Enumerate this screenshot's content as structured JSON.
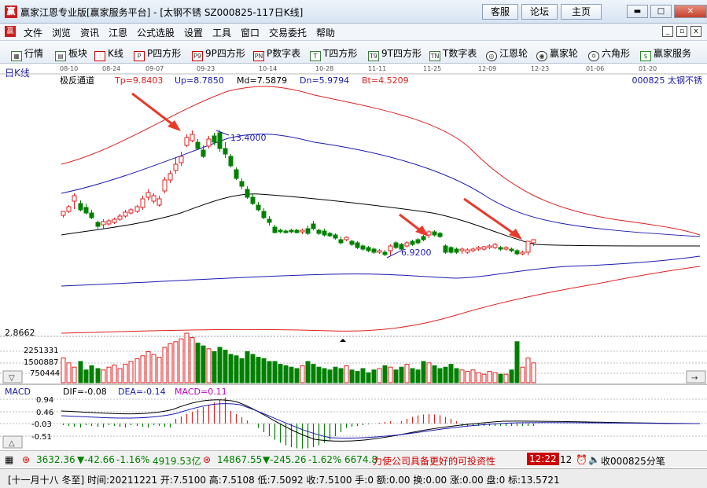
{
  "window": {
    "title": "赢家江恩专业版[赢家服务平台] - [太钢不锈  SZ000825-117日K线]",
    "logo": "赢",
    "btn_kefu": "客服",
    "btn_luntan": "论坛",
    "btn_zhuye": "主页"
  },
  "menu": [
    "文件",
    "浏览",
    "资讯",
    "江恩",
    "公式选股",
    "设置",
    "工具",
    "窗口",
    "交易委托",
    "帮助"
  ],
  "toolbar": [
    "行情",
    "板块",
    "K线",
    "P四方形",
    "9P四方形",
    "P数字表",
    "T四方形",
    "9T四方形",
    "T数字表",
    "江恩轮",
    "赢家轮",
    "六角形",
    "赢家服务"
  ],
  "toolbar_icons": [
    "table-icon",
    "grid-icon",
    "candle-icon",
    "P",
    "P9",
    "PN",
    "T",
    "T9",
    "TN",
    "wheel-icon",
    "wheel-icon",
    "hex-icon",
    "dollar-icon"
  ],
  "chart": {
    "period_label": "日K线",
    "indicator": "极反通道",
    "tp": "Tp=9.8403",
    "up": "Up=8.7850",
    "md": "Md=7.5879",
    "dn": "Dn=5.9794",
    "bt": "Bt=4.5209",
    "stock": "000825  太钢不锈",
    "dates": [
      "08-10",
      "08-24",
      "09-07",
      "09-23",
      "10-14",
      "10-28",
      "11-11",
      "11-25",
      "12-09",
      "12-23",
      "01-06",
      "01-20"
    ],
    "high_label": "13.4000",
    "low_label": "6.9200",
    "vol_label": "2.8662",
    "vol_ticks": [
      "2251331",
      "1500887",
      "750444"
    ],
    "macd_name": "MACD",
    "dif": "DIF=-0.08",
    "dea": "DEA=-0.14",
    "macd": "MACD=0.11",
    "macd_ticks": [
      "0.94",
      "0.46",
      "-0.03",
      "-0.51"
    ],
    "colors": {
      "up": "#e02020",
      "down": "#008000",
      "upper_outer": "#e02020",
      "upper_inner": "#1a1ab0",
      "mid": "#000000",
      "macd_pos": "#e02020",
      "macd_neg": "#008000"
    }
  },
  "status": {
    "idx1": "3632.36",
    "idx1_chg": "▼-42.66",
    "idx1_pct": "-1.16%",
    "idx1_amt": "4919.53亿",
    "idx2": "14867.55",
    "idx2_chg": "▼-245.26",
    "idx2_pct": "-1.62%",
    "idx2_amt": "6674.8",
    "ticker": "力使公司具备更好的可投资性",
    "time": "12:22",
    "num": "12",
    "recv": "收000825分笔"
  },
  "info": "[十一月十八 冬至] 时间:20211221 开:7.5100 高:7.5108 低:7.5092 收:7.5100 手:0 额:0.00 换:0.00 涨:0.00 盘:0 标:13.5721"
}
